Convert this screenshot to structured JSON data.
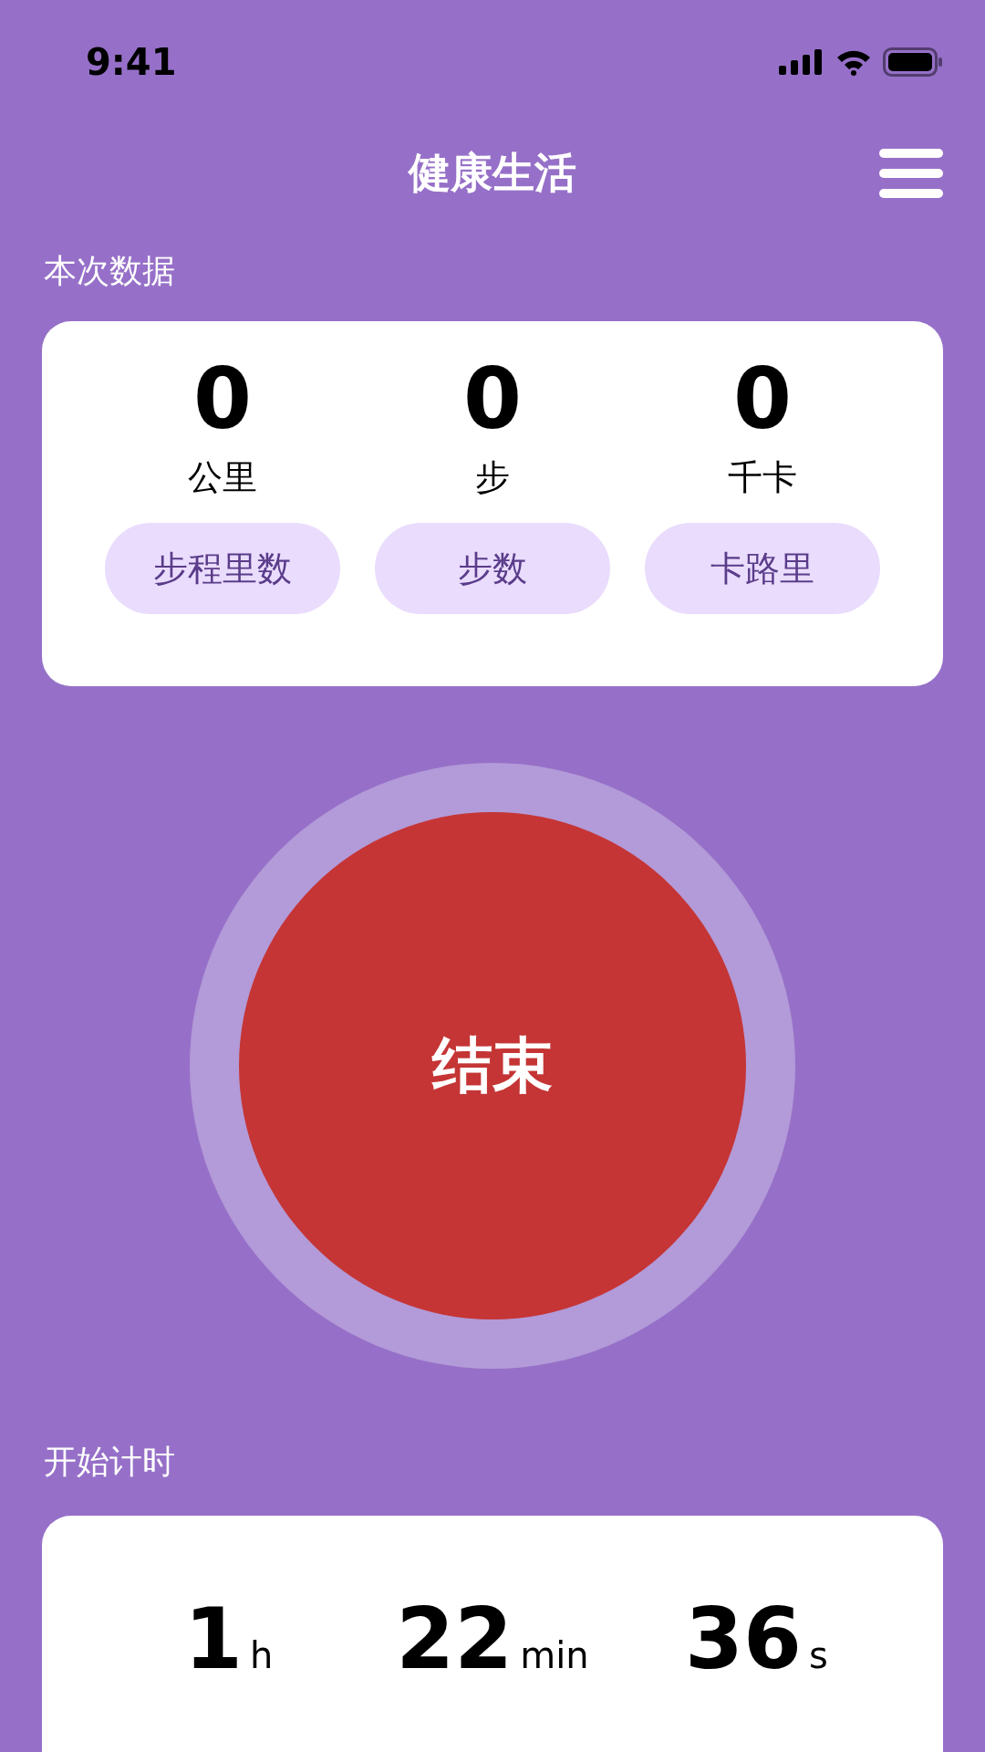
{
  "status_bar": {
    "time": "9:41"
  },
  "header": {
    "title": "健康生活"
  },
  "session": {
    "label": "本次数据",
    "stats": [
      {
        "value": "0",
        "unit": "公里",
        "button": "步程里数"
      },
      {
        "value": "0",
        "unit": "步",
        "button": "步数"
      },
      {
        "value": "0",
        "unit": "千卡",
        "button": "卡路里"
      }
    ]
  },
  "action_button": {
    "label": "结束"
  },
  "timer": {
    "label": "开始计时",
    "parts": [
      {
        "value": "1",
        "unit": "h"
      },
      {
        "value": "22",
        "unit": "min"
      },
      {
        "value": "36",
        "unit": "s"
      }
    ]
  }
}
